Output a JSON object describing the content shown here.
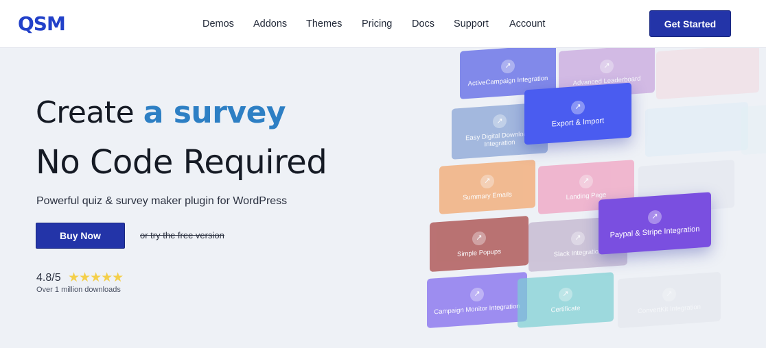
{
  "header": {
    "logo": "QSM",
    "nav": [
      "Demos",
      "Addons",
      "Themes",
      "Pricing",
      "Docs",
      "Support",
      "Account"
    ],
    "cta": "Get Started"
  },
  "hero": {
    "line1_prefix": "Create ",
    "line1_accent": "a survey",
    "line2": "No Code Required",
    "subtitle": "Powerful quiz & survey maker plugin for WordPress",
    "buy_label": "Buy Now",
    "free_label": "or try the free version",
    "rating": "4.8/5",
    "stars": "★★★★★",
    "downloads": "Over 1 million downloads"
  },
  "tiles": [
    {
      "label": "ActiveCampaign Integration",
      "icon": "arrow-icon",
      "color": "#6f78e8"
    },
    {
      "label": "Advanced Leaderboard",
      "icon": "leaderboard-icon",
      "color": "#c7a4dd"
    },
    {
      "label": "",
      "icon": "",
      "color": "#f1d6dc"
    },
    {
      "label": "Export & Import",
      "icon": "export-icon",
      "color": "#4a5cf0"
    },
    {
      "label": "Easy Digital Downloads Integration",
      "icon": "download-icon",
      "color": "#8aa6d6"
    },
    {
      "label": "",
      "icon": "",
      "color": "#d9ecf6"
    },
    {
      "label": "",
      "icon": "",
      "color": "#e2f0f6"
    },
    {
      "label": "Summary Emails",
      "icon": "mail-icon",
      "color": "#f2ad78"
    },
    {
      "label": "Landing Page",
      "icon": "page-icon",
      "color": "#f0a3c2"
    },
    {
      "label": "",
      "icon": "",
      "color": "#dde2ea"
    },
    {
      "label": "Paypal & Stripe Integration",
      "icon": "card-icon",
      "color": "#7a4fe0"
    },
    {
      "label": "Simple Popups",
      "icon": "popup-icon",
      "color": "#b05c5c"
    },
    {
      "label": "Slack Integration",
      "icon": "slack-icon",
      "color": "#c3b5cf"
    },
    {
      "label": "Campaign Monitor Integration",
      "icon": "monitor-icon",
      "color": "#8f7cf0"
    },
    {
      "label": "Certificate",
      "icon": "certificate-icon",
      "color": "#7ccfd3"
    },
    {
      "label": "ConvertKit Integration",
      "icon": "convertkit-icon",
      "color": "#dfe3ea"
    }
  ],
  "colors": {
    "primary": "#2334a8",
    "accent": "#2d7fc4",
    "star": "#f4cf4a",
    "background": "#eef1f6"
  }
}
